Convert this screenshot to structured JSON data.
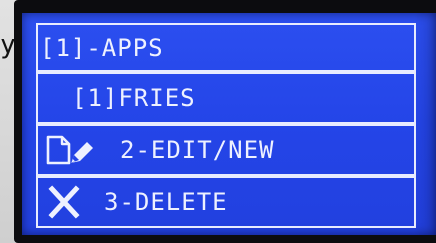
{
  "menu": {
    "items": [
      {
        "label": "[1]-APPS",
        "icon": ""
      },
      {
        "label": "[1]FRIES",
        "icon": ""
      },
      {
        "label": "2-EDIT/NEW",
        "icon": "document-pencil-icon"
      },
      {
        "label": "3-DELETE",
        "icon": "close-icon"
      }
    ]
  },
  "colors": {
    "screen_background": "#2445e8",
    "text": "#eef1ff",
    "border": "#e8ecff",
    "bezel": "#0c0c0f"
  },
  "edge_glyph": "y"
}
